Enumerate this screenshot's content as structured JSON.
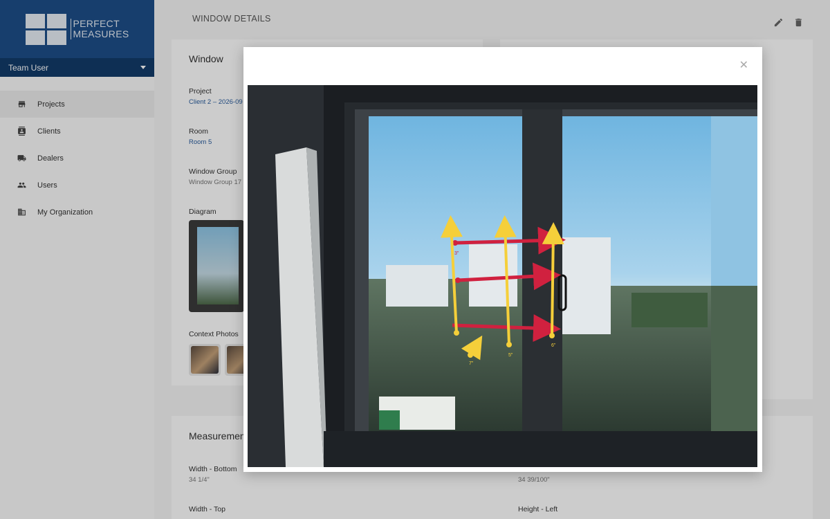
{
  "brand": {
    "line1": "PERFECT",
    "line2": "MEASURES"
  },
  "user": {
    "name": "Team User"
  },
  "nav": {
    "items": [
      {
        "label": "Projects",
        "icon": "store-icon"
      },
      {
        "label": "Clients",
        "icon": "contact-card-icon"
      },
      {
        "label": "Dealers",
        "icon": "truck-icon"
      },
      {
        "label": "Users",
        "icon": "people-icon"
      },
      {
        "label": "My Organization",
        "icon": "building-icon"
      }
    ]
  },
  "page": {
    "title": "WINDOW DETAILS"
  },
  "window_card": {
    "title": "Window",
    "project_label": "Project",
    "project_value": "Client 2 – 2026-09",
    "room_label": "Room",
    "room_value": "Room 5",
    "group_label": "Window Group",
    "group_value": "Window Group 17",
    "diagram_label": "Diagram",
    "context_label": "Context Photos"
  },
  "measurements_card": {
    "title": "Measurements",
    "width_bottom_label": "Width - Bottom",
    "width_bottom_value": "34 1/4\"",
    "right_value": "34 39/100\"",
    "width_top_label": "Width - Top",
    "height_left_label": "Height - Left"
  },
  "annotations": [
    "3\"",
    "5\"",
    "6\"",
    "7\""
  ],
  "colors": {
    "brand": "#1d4e89",
    "brand_dark": "#123b6a",
    "arrow_red": "#d0213f",
    "arrow_yellow": "#f5cf3a"
  }
}
